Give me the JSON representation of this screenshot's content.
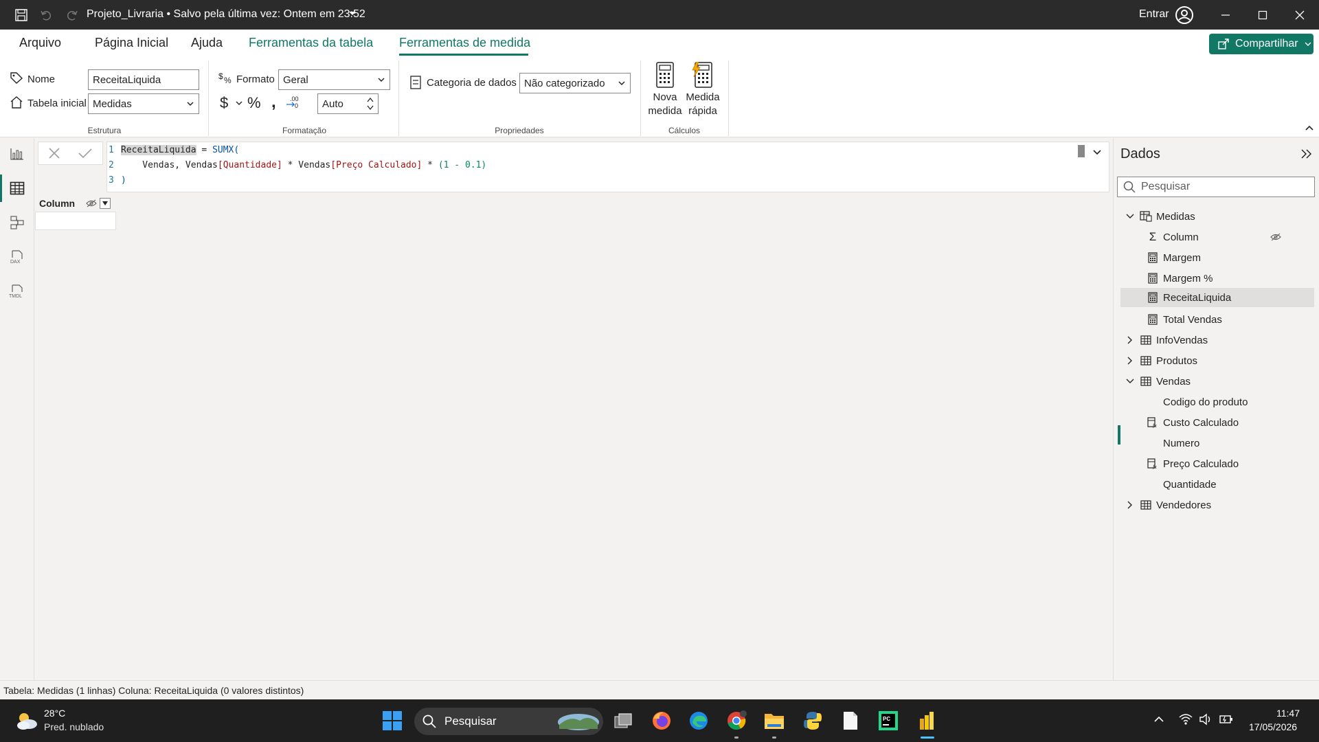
{
  "titlebar": {
    "doc_title": "Projeto_Livraria • Salvo pela última vez: Ontem em 23:52",
    "signin": "Entrar"
  },
  "ribbon": {
    "tabs": [
      "Arquivo",
      "Página Inicial",
      "Ajuda",
      "Ferramentas da tabela",
      "Ferramentas de medida"
    ],
    "share_label": "Compartilhar",
    "estrutura": {
      "name_label": "Nome",
      "name_value": "ReceitaLiquida",
      "home_table_label": "Tabela inicial",
      "home_table_value": "Medidas",
      "group_label": "Estrutura"
    },
    "formatacao": {
      "format_label": "Formato",
      "format_value": "Geral",
      "decimals_value": "Auto",
      "group_label": "Formatação"
    },
    "propriedades": {
      "category_label": "Categoria de dados",
      "category_value": "Não categorizado",
      "group_label": "Propriedades"
    },
    "calculos": {
      "new_measure_line1": "Nova",
      "new_measure_line2": "medida",
      "quick_measure_line1": "Medida",
      "quick_measure_line2": "rápida",
      "group_label": "Cálculos"
    }
  },
  "formula": {
    "line_numbers": [
      "1",
      "2",
      "3"
    ],
    "l1_measure": "ReceitaLiquida",
    "l1_eq": " = ",
    "l1_fn": "SUMX(",
    "l2_indent": "    Vendas, Vendas",
    "l2_col1": "[Quantidade]",
    "l2_mid": " * Vendas",
    "l2_col2": "[Preço Calculado]",
    "l2_op": " * ",
    "l2_expr": "(1 - 0.1)",
    "l3": ")"
  },
  "grid": {
    "column_header": "Column"
  },
  "data_pane": {
    "title": "Dados",
    "search_placeholder": "Pesquisar",
    "items": [
      {
        "label": "Medidas"
      },
      {
        "label": "Column"
      },
      {
        "label": "Margem"
      },
      {
        "label": "Margem %"
      },
      {
        "label": "ReceitaLiquida"
      },
      {
        "label": "Total Vendas"
      },
      {
        "label": "InfoVendas"
      },
      {
        "label": "Produtos"
      },
      {
        "label": "Vendas"
      },
      {
        "label": "Codigo do produto"
      },
      {
        "label": "Custo Calculado"
      },
      {
        "label": "Numero"
      },
      {
        "label": "Preço Calculado"
      },
      {
        "label": "Quantidade"
      },
      {
        "label": "Vendedores"
      }
    ]
  },
  "statusbar": {
    "text": "Tabela: Medidas (1 linhas) Coluna: ReceitaLiquida (0 valores distintos)"
  },
  "taskbar": {
    "temperature": "28°C",
    "weather": "Pred. nublado",
    "search": "Pesquisar",
    "time": "11:47",
    "date": "17/05/2026"
  },
  "colors": {
    "accent": "#117865",
    "titlebar": "#2b2b2b",
    "taskbar": "#1f1f1f"
  }
}
